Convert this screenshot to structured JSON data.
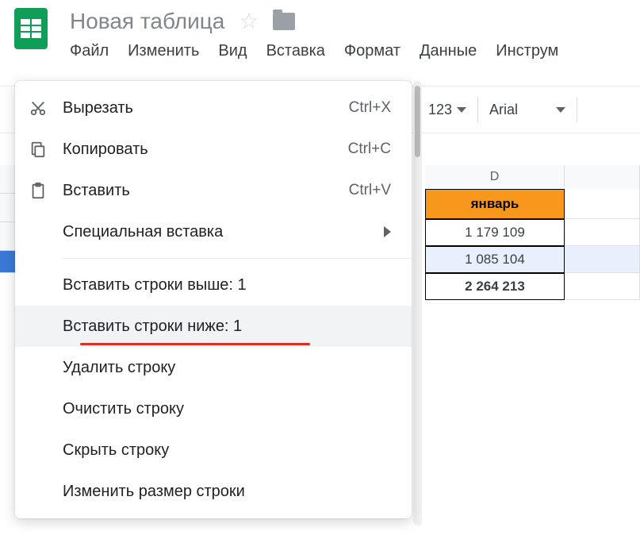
{
  "doc_title": "Новая таблица",
  "menubar": {
    "file": "Файл",
    "edit": "Изменить",
    "view": "Вид",
    "insert": "Вставка",
    "format": "Формат",
    "data": "Данные",
    "tools": "Инструм"
  },
  "toolbar": {
    "number_format": "123",
    "font": "Arial"
  },
  "columns": {
    "d": "D"
  },
  "table": {
    "header_month": "январь",
    "r1": "1 179 109",
    "r2": "1 085 104",
    "r3": "2 264 213"
  },
  "context_menu": {
    "cut": {
      "label": "Вырезать",
      "shortcut": "Ctrl+X"
    },
    "copy": {
      "label": "Копировать",
      "shortcut": "Ctrl+C"
    },
    "paste": {
      "label": "Вставить",
      "shortcut": "Ctrl+V"
    },
    "paste_special": "Специальная вставка",
    "insert_above": "Вставить строки выше: 1",
    "insert_below": "Вставить строки ниже: 1",
    "delete_row": "Удалить строку",
    "clear_row": "Очистить строку",
    "hide_row": "Скрыть строку",
    "resize_row": "Изменить размер строки"
  }
}
